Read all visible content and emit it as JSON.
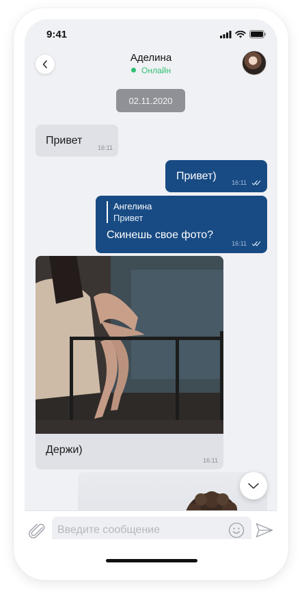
{
  "status_bar": {
    "time": "9:41"
  },
  "header": {
    "contact_name": "Аделина",
    "contact_status": "Онлайн"
  },
  "date_separator": "02.11.2020",
  "messages": [
    {
      "direction": "incoming",
      "text": "Привет",
      "time": "16:11"
    },
    {
      "direction": "outgoing",
      "text": "Привет)",
      "time": "16:11",
      "read": true
    },
    {
      "direction": "outgoing",
      "reply_to": {
        "author": "Ангелина",
        "text": "Привет"
      },
      "text": "Скинешь свое фото?",
      "time": "16:11",
      "read": true
    },
    {
      "direction": "incoming",
      "type": "photo",
      "caption": "Держи)",
      "time": "16:11"
    },
    {
      "direction": "outgoing",
      "type": "photo"
    }
  ],
  "composer": {
    "placeholder": "Введите сообщение"
  },
  "icons": {
    "back": "chevron-left-icon",
    "scroll_down": "chevron-down-icon",
    "attach": "paperclip-icon",
    "emoji": "smiley-icon",
    "send": "send-icon",
    "read": "double-check-icon"
  },
  "colors": {
    "outgoing_bubble": "#184b84",
    "incoming_bubble": "#dfe1e6",
    "online": "#2fbf71",
    "date_chip": "#8f9196"
  }
}
